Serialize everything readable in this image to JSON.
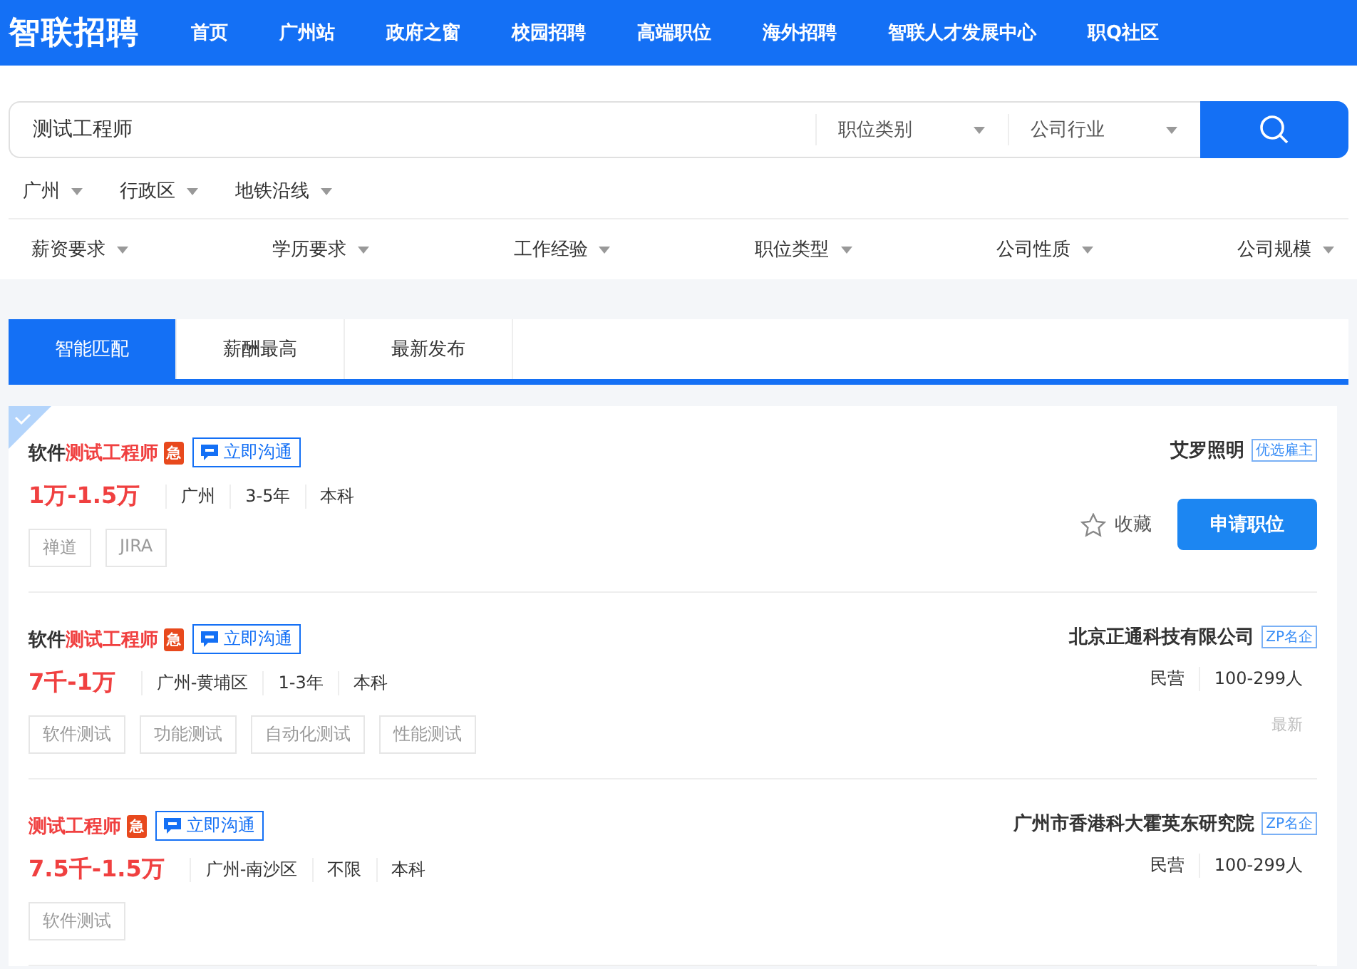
{
  "header": {
    "logo": "智联招聘",
    "nav": [
      "首页",
      "广州站",
      "政府之窗",
      "校园招聘",
      "高端职位",
      "海外招聘",
      "智联人才发展中心",
      "职Q社区"
    ]
  },
  "search": {
    "value": "测试工程师",
    "selects": [
      "职位类别",
      "公司行业"
    ]
  },
  "location_filters": [
    "广州",
    "行政区",
    "地铁沿线"
  ],
  "filters": [
    "薪资要求",
    "学历要求",
    "工作经验",
    "职位类型",
    "公司性质",
    "公司规模"
  ],
  "sort_tabs": [
    {
      "label": "智能匹配",
      "selected": true
    },
    {
      "label": "薪酬最高",
      "selected": false
    },
    {
      "label": "最新发布",
      "selected": false
    }
  ],
  "jobs": [
    {
      "marked": true,
      "title": [
        {
          "text": "软件",
          "highlight": false
        },
        {
          "text": "测试工程师",
          "highlight": true
        }
      ],
      "urgent": "急",
      "chat": "立即沟通",
      "salary": "1万-1.5万",
      "meta": [
        "广州",
        "3-5年",
        "本科"
      ],
      "tags": [
        "禅道",
        "JIRA"
      ],
      "company": "艾罗照明",
      "company_badge": "优选雇主",
      "collect": "收藏",
      "apply": "申请职位"
    },
    {
      "marked": false,
      "title": [
        {
          "text": "软件",
          "highlight": false
        },
        {
          "text": "测试工程师",
          "highlight": true
        }
      ],
      "urgent": "急",
      "chat": "立即沟通",
      "salary": "7千-1万",
      "meta": [
        "广州-黄埔区",
        "1-3年",
        "本科"
      ],
      "tags": [
        "软件测试",
        "功能测试",
        "自动化测试",
        "性能测试"
      ],
      "company": "北京正通科技有限公司",
      "company_badge": "ZP名企",
      "company_info": [
        "民营",
        "100-299人"
      ],
      "posted": "最新"
    },
    {
      "marked": false,
      "title": [
        {
          "text": "测试工程师",
          "highlight": true
        }
      ],
      "urgent": "急",
      "chat": "立即沟通",
      "salary": "7.5千-1.5万",
      "meta": [
        "广州-南沙区",
        "不限",
        "本科"
      ],
      "tags": [
        "软件测试"
      ],
      "company": "广州市香港科大霍英东研究院",
      "company_badge": "ZP名企",
      "company_info": [
        "民营",
        "100-299人"
      ]
    }
  ]
}
